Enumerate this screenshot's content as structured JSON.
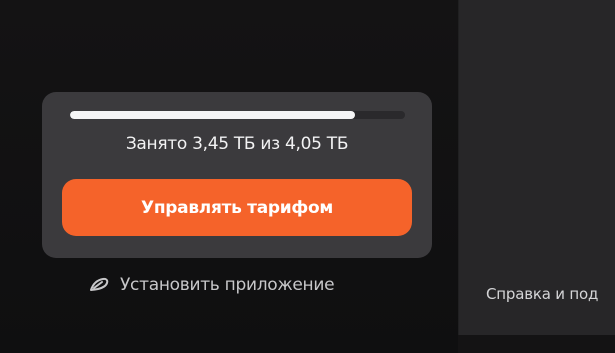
{
  "storage": {
    "used_fraction": 0.85,
    "usage_text": "Занято 3,45 ТБ из 4,05 ТБ",
    "manage_button_label": "Управлять тарифом"
  },
  "install_app": {
    "label": "Установить приложение",
    "icon": "app-install-icon"
  },
  "right_panel": {
    "help_link_label": "Справка и под"
  },
  "colors": {
    "background": "#141314",
    "card": "#3b3a3d",
    "accent": "#f5632a",
    "progress_fill": "#f5f5f6",
    "right_panel": "#272628"
  }
}
